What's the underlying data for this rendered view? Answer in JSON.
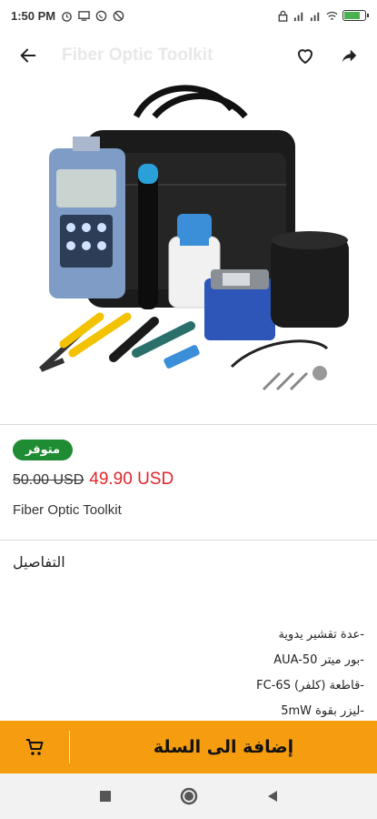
{
  "status_bar": {
    "time": "1:50 PM",
    "battery_level": 0.7
  },
  "app_bar": {
    "title": "Fiber Optic Toolkit",
    "back_icon": "arrow-left-icon",
    "favorite_icon": "heart-outline-icon",
    "share_icon": "share-arrow-icon"
  },
  "product": {
    "image_alt": "fiber-optic-toolkit-product-photo",
    "stock_badge": "متوفر",
    "old_price": "50.00 USD",
    "new_price": "49.90 USD",
    "name": "Fiber Optic Toolkit"
  },
  "details": {
    "title": "التفاصيل",
    "lines": [
      "-عدة تقشير يدوية",
      "-بور ميتر AUA-50",
      "-قاطعة (كلفر) FC-6S",
      "-ليزر بقوة 5mW"
    ]
  },
  "cart": {
    "label": "إضافة الى السلة",
    "icon": "cart-icon"
  },
  "nav_bar": {
    "recents_icon": "square-icon",
    "home_icon": "circle-icon",
    "back_icon": "triangle-back-icon"
  },
  "colors": {
    "accent": "#f59d0f",
    "in_stock": "#1f8c33",
    "sale_price": "#e1262b"
  }
}
